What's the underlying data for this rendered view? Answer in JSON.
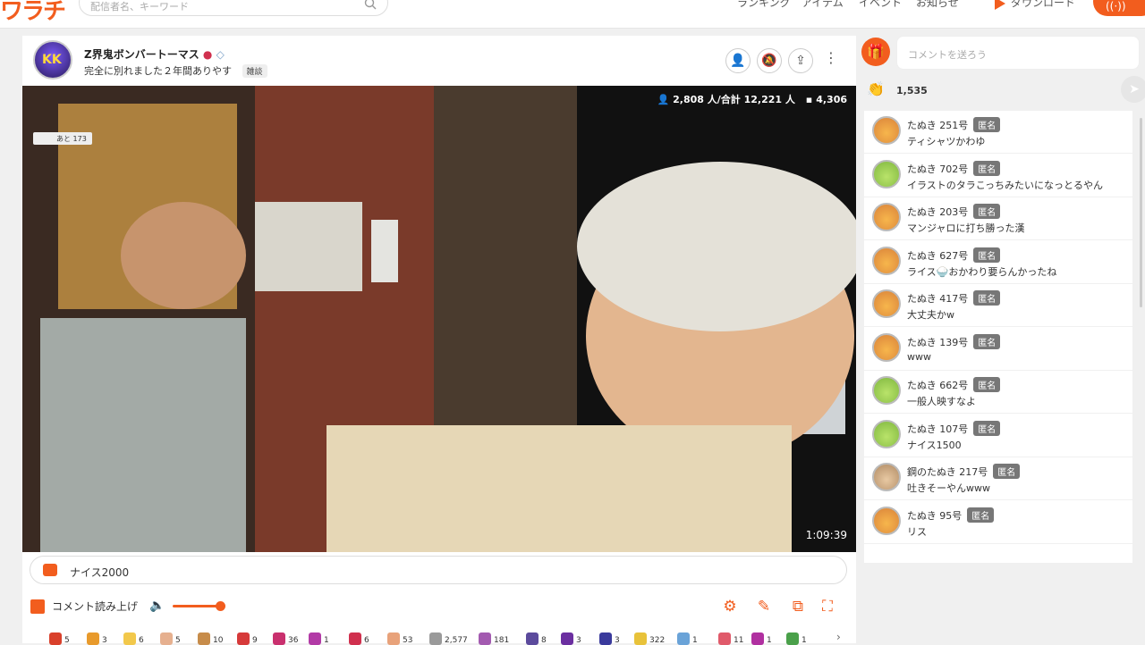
{
  "topnav": {
    "logo": "ワラチ",
    "search_placeholder": "配信者名、キーワード",
    "items": [
      "ランキング",
      "アイテム",
      "イベント",
      "お知らせ"
    ],
    "download": "ダウンロード",
    "live_label": "((·))"
  },
  "channel": {
    "avatar_text": "KK",
    "name": "Z界鬼ボンバートーマス",
    "title": "完全に別れました２年間ありやす",
    "tag": "雑談"
  },
  "video": {
    "viewers": "2,808 人/合計 12,221 人",
    "comments": "4,306",
    "elapsed": "1:09:39",
    "mini_badge": "あと 173"
  },
  "comment_bar": {
    "text": "ナイス2000"
  },
  "controls": {
    "read_aloud": "コメント読み上げ",
    "volume": 0.9
  },
  "gifts": [
    {
      "count": "5",
      "color": "#d9402b"
    },
    {
      "count": "3",
      "color": "#e89a2c"
    },
    {
      "count": "6",
      "color": "#f2c84b"
    },
    {
      "count": "5",
      "color": "#e6b08f"
    },
    {
      "count": "10",
      "color": "#c78c4a"
    },
    {
      "count": "9",
      "color": "#d63a3a"
    },
    {
      "count": "36",
      "color": "#c9306e"
    },
    {
      "count": "1",
      "color": "#b23aa6"
    },
    {
      "count": "6",
      "color": "#d0304e"
    },
    {
      "count": "53",
      "color": "#e8a27a"
    },
    {
      "count": "2,577",
      "color": "#9a9a9a"
    },
    {
      "count": "181",
      "color": "#a35ab0"
    },
    {
      "count": "8",
      "color": "#5b4a9c"
    },
    {
      "count": "3",
      "color": "#6b2fa0"
    },
    {
      "count": "3",
      "color": "#3a3a9c"
    },
    {
      "count": "322",
      "color": "#e8c23a"
    },
    {
      "count": "1",
      "color": "#6aa3d8"
    },
    {
      "count": "11",
      "color": "#e05a6a"
    },
    {
      "count": "1",
      "color": "#b030a0"
    },
    {
      "count": "1",
      "color": "#4aa04a"
    }
  ],
  "sidebar": {
    "comment_placeholder": "コメントを送ろう",
    "clap_count": "1,535",
    "anon_label": "匿名",
    "messages": [
      {
        "name": "たぬき 251号",
        "text": "ティシャツかわゆ",
        "avatar": "orange"
      },
      {
        "name": "たぬき 702号",
        "text": "イラストのタラこっちみたいになっとるやん",
        "avatar": "green"
      },
      {
        "name": "たぬき 203号",
        "text": "マンジャロに打ち勝った漢",
        "avatar": "orange"
      },
      {
        "name": "たぬき 627号",
        "text": "ライス🍚おかわり要らんかったね",
        "avatar": "orange"
      },
      {
        "name": "たぬき 417号",
        "text": "大丈夫かw",
        "avatar": "orange"
      },
      {
        "name": "たぬき 139号",
        "text": "www",
        "avatar": "orange"
      },
      {
        "name": "たぬき 662号",
        "text": "一般人映すなよ",
        "avatar": "green"
      },
      {
        "name": "たぬき 107号",
        "text": "ナイス1500",
        "avatar": "green"
      },
      {
        "name": "鋼のたぬき 217号",
        "text": "吐きそーやんwww",
        "avatar": "tan"
      },
      {
        "name": "たぬき 95号",
        "text": "リス",
        "avatar": "orange"
      }
    ]
  }
}
